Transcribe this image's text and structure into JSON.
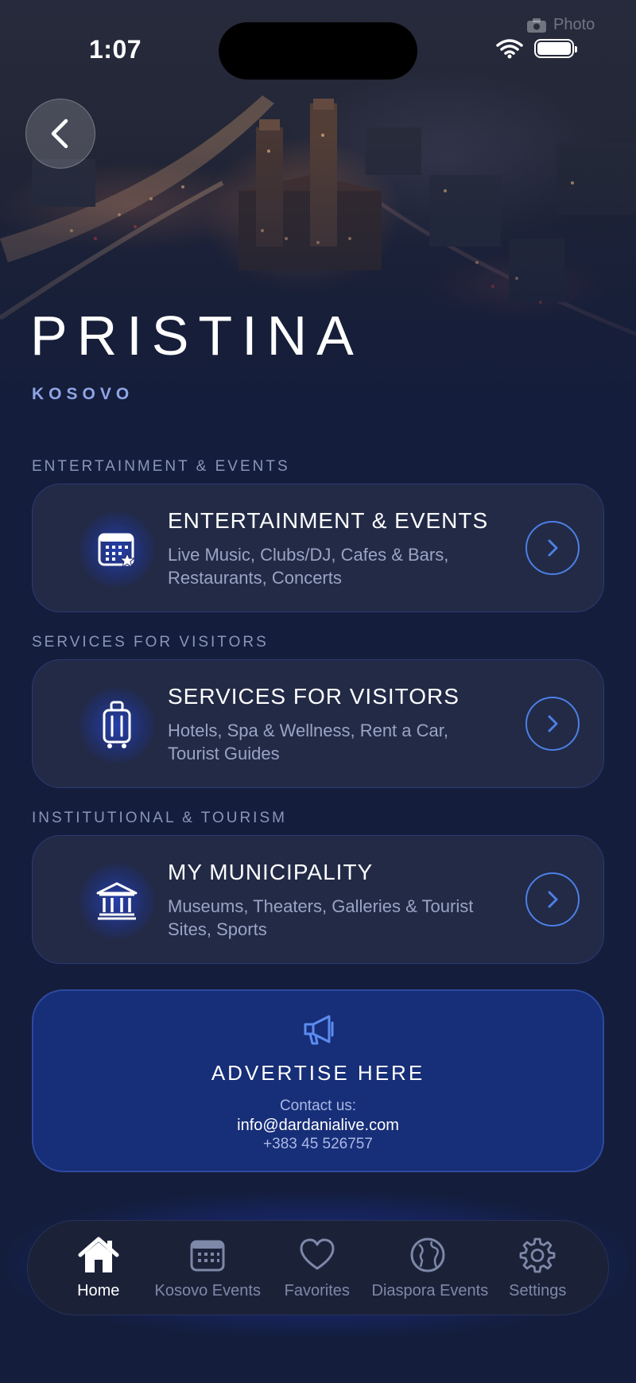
{
  "status_bar": {
    "time": "1:07",
    "photo_label": "Photo"
  },
  "header": {
    "back_icon": "chevron-left-icon",
    "city": "PRISTINA",
    "country": "KOSOVO"
  },
  "sections": [
    {
      "label": "ENTERTAINMENT & EVENTS",
      "title": "ENTERTAINMENT & EVENTS",
      "description": "Live Music, Clubs/DJ, Cafes & Bars, Restaurants, Concerts",
      "icon": "calendar-star-icon"
    },
    {
      "label": "SERVICES FOR VISITORS",
      "title": "SERVICES FOR VISITORS",
      "description": "Hotels, Spa & Wellness, Rent a Car, Tourist Guides",
      "icon": "luggage-icon"
    },
    {
      "label": "INSTITUTIONAL & TOURISM",
      "title": "MY MUNICIPALITY",
      "description": "Museums, Theaters, Galleries & Tourist Sites, Sports",
      "icon": "museum-icon"
    }
  ],
  "ad": {
    "icon": "megaphone-icon",
    "title": "ADVERTISE HERE",
    "contact_label": "Contact us:",
    "email": "info@dardanialive.com",
    "phone": "+383 45 526757"
  },
  "tabbar": {
    "items": [
      {
        "label": "Home",
        "icon": "home-icon",
        "active": true
      },
      {
        "label": "Kosovo Events",
        "icon": "calendar-icon",
        "active": false
      },
      {
        "label": "Favorites",
        "icon": "heart-icon",
        "active": false
      },
      {
        "label": "Diaspora Events",
        "icon": "globe-icon",
        "active": false
      },
      {
        "label": "Settings",
        "icon": "gear-icon",
        "active": false
      }
    ]
  },
  "colors": {
    "background": "#141d3b",
    "card": "#222a46",
    "accent": "#4d7fe6",
    "ad_background": "#172e78"
  }
}
